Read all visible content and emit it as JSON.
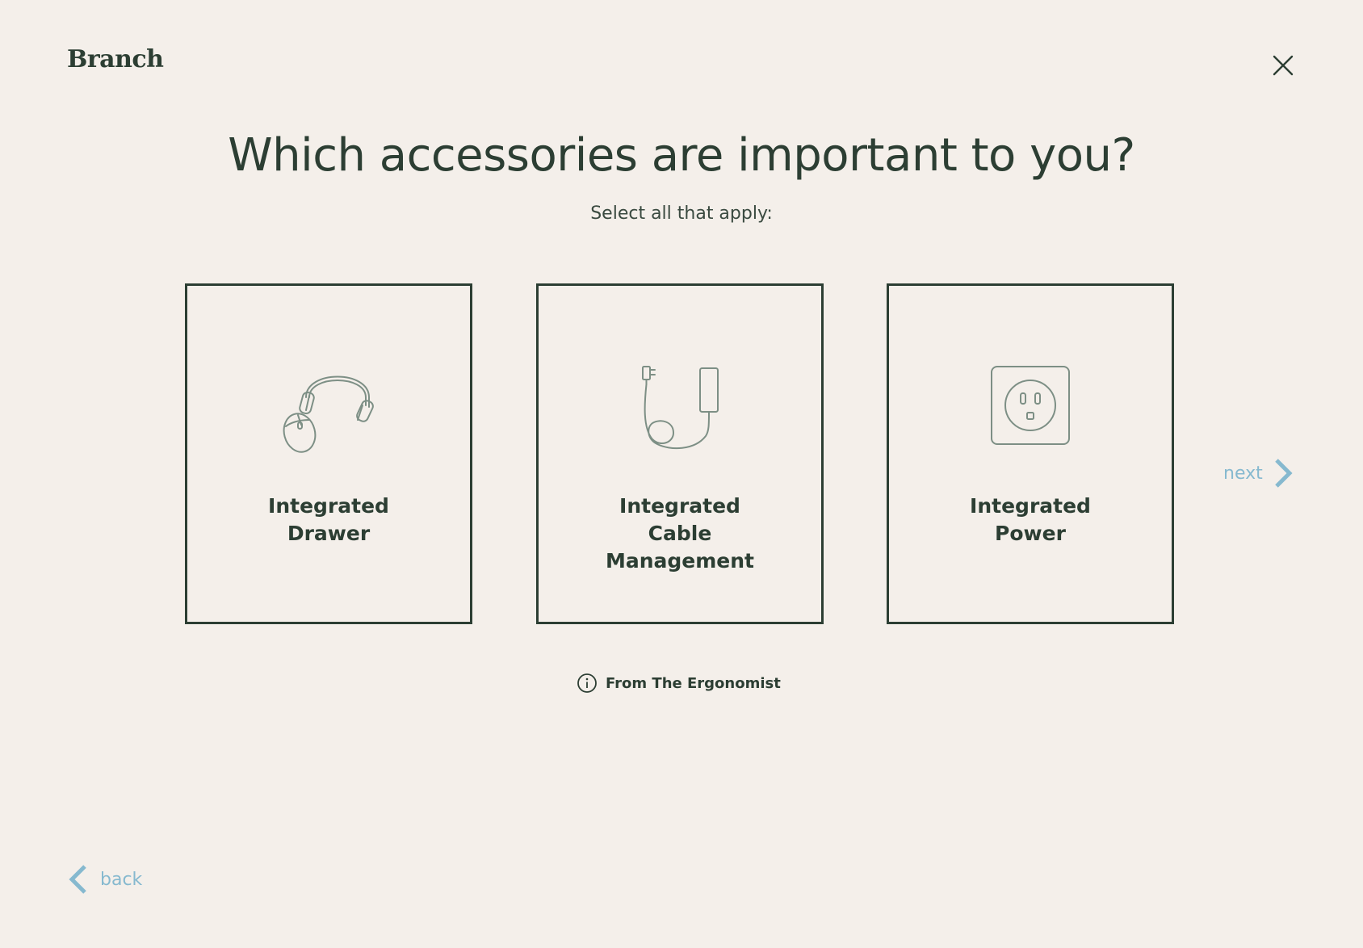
{
  "header": {
    "logo": "Branch",
    "close_icon": "close-icon"
  },
  "question": {
    "title": "Which accessories are important to you?",
    "subtitle": "Select all that apply:"
  },
  "options": [
    {
      "label": "Integrated\nDrawer",
      "icon": "headphones-mouse-icon"
    },
    {
      "label": "Integrated\nCable\nManagement",
      "icon": "cable-charger-icon"
    },
    {
      "label": "Integrated\nPower",
      "icon": "power-outlet-icon"
    }
  ],
  "info": {
    "label": "From The Ergonomist",
    "icon": "info-icon"
  },
  "navigation": {
    "next_label": "next",
    "back_label": "back",
    "next_icon": "chevron-right-icon",
    "back_icon": "chevron-left-icon"
  },
  "colors": {
    "background": "#f4efea",
    "text": "#2c3e33",
    "accent": "#86b9cf",
    "icon_stroke": "#7d8f85"
  }
}
